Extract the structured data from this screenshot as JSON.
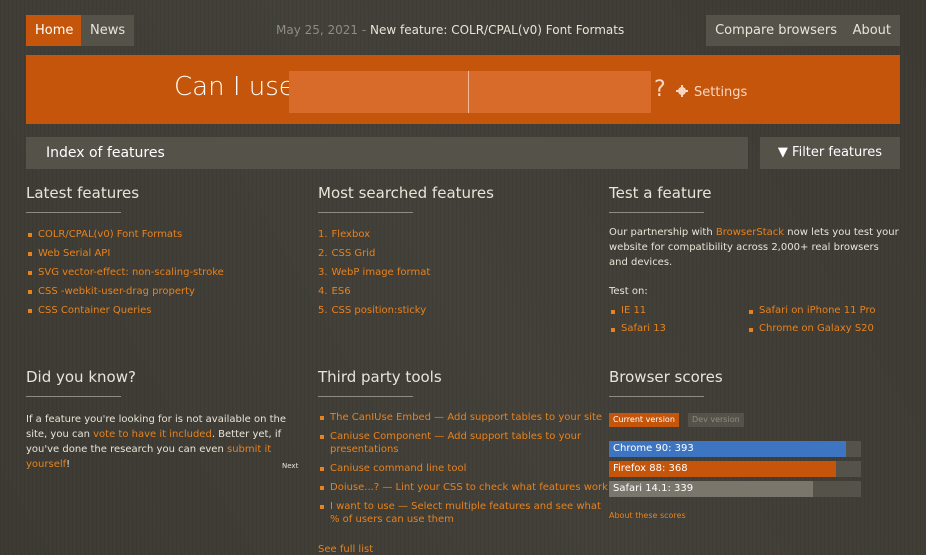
{
  "nav": {
    "home": "Home",
    "news": "News",
    "news_date": "May 25, 2021",
    "news_sep": " - ",
    "news_text": "New feature: COLR/CPAL(v0) Font Formats",
    "compare": "Compare browsers",
    "about": "About"
  },
  "banner": {
    "title": "Can I use",
    "question": "?",
    "settings": "Settings",
    "search_a_value": "",
    "search_b_value": ""
  },
  "index": {
    "title": "Index of features",
    "filter": "Filter features"
  },
  "latest": {
    "title": "Latest features",
    "items": [
      "COLR/CPAL(v0) Font Formats",
      "Web Serial API",
      "SVG vector-effect: non-scaling-stroke",
      "CSS -webkit-user-drag property",
      "CSS Container Queries"
    ]
  },
  "most_searched": {
    "title": "Most searched features",
    "items": [
      {
        "n": "1.",
        "label": "Flexbox"
      },
      {
        "n": "2.",
        "label": "CSS Grid"
      },
      {
        "n": "3.",
        "label": "WebP image format"
      },
      {
        "n": "4.",
        "label": "ES6"
      },
      {
        "n": "5.",
        "label": "CSS position:sticky"
      }
    ]
  },
  "test": {
    "title": "Test a feature",
    "para_1": "Our partnership with ",
    "para_link": "BrowserStack",
    "para_2": " now lets you test your website for compatibility across 2,000+ real browsers and devices.",
    "test_on": "Test on:",
    "browsers": [
      "IE 11",
      "Safari on iPhone 11 Pro",
      "Safari 13",
      "Chrome on Galaxy S20"
    ]
  },
  "did_you_know": {
    "title": "Did you know?",
    "p1": "If a feature you're looking for is not available on the site, you can ",
    "link1": "vote to have it included",
    "p2": ". Better yet, if you've done the research you can even ",
    "link2": "submit it yourself",
    "p3": "!",
    "next": "Next"
  },
  "third_party": {
    "title": "Third party tools",
    "items": [
      "The CanIUse Embed — Add support tables to your site",
      "Caniuse Component — Add support tables to your presentations",
      "Caniuse command line tool",
      "Doiuse...? — Lint your CSS to check what features work",
      "I want to use — Select multiple features and see what % of users can use them"
    ],
    "see_full": "See full list"
  },
  "scores": {
    "title": "Browser scores",
    "tab_current": "Current version",
    "tab_dev": "Dev version",
    "bars": [
      {
        "label": "Chrome 90: 393",
        "fraction": 0.94,
        "color": "#3d75c2"
      },
      {
        "label": "Firefox 88: 368",
        "fraction": 0.9,
        "color": "#c4550a"
      },
      {
        "label": "Safari 14.1: 339",
        "fraction": 0.81,
        "color": "#7a766c"
      }
    ],
    "about": "About these scores"
  }
}
